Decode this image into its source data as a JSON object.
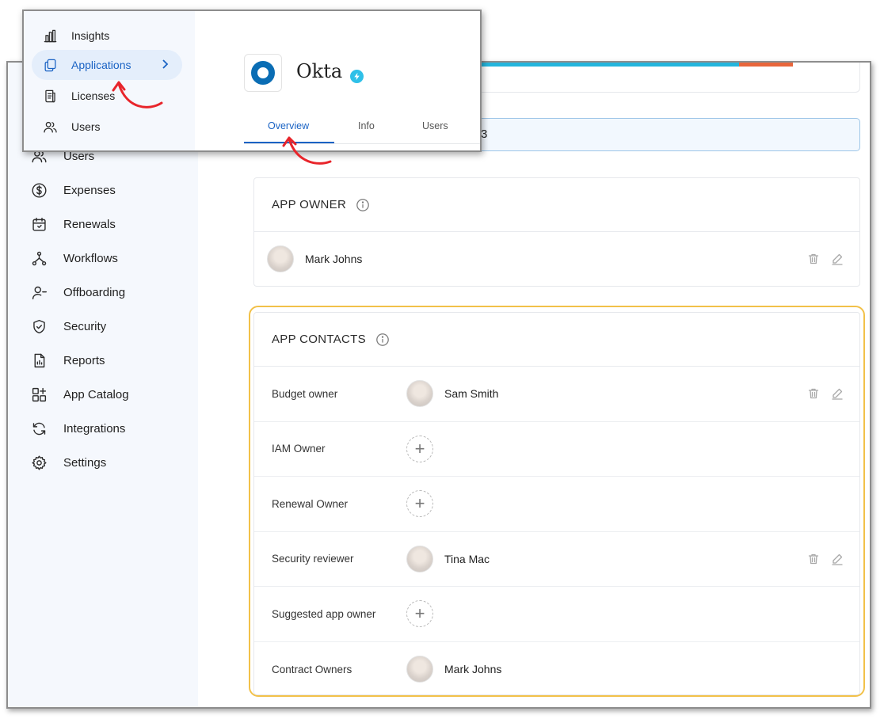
{
  "sidebar": {
    "items": [
      {
        "label": "Users",
        "icon": "users-icon"
      },
      {
        "label": "Expenses",
        "icon": "dollar-icon"
      },
      {
        "label": "Renewals",
        "icon": "calendar-icon"
      },
      {
        "label": "Workflows",
        "icon": "workflow-icon"
      },
      {
        "label": "Offboarding",
        "icon": "user-minus-icon"
      },
      {
        "label": "Security",
        "icon": "shield-icon"
      },
      {
        "label": "Reports",
        "icon": "report-icon"
      },
      {
        "label": "App Catalog",
        "icon": "grid-plus-icon"
      },
      {
        "label": "Integrations",
        "icon": "sync-icon"
      },
      {
        "label": "Settings",
        "icon": "gear-icon"
      }
    ]
  },
  "banner": {
    "fragment": "3"
  },
  "app_owner": {
    "title": "APP OWNER",
    "owner_name": "Mark Johns"
  },
  "app_contacts": {
    "title": "APP CONTACTS",
    "rows": [
      {
        "label": "Budget owner",
        "name": "Sam Smith"
      },
      {
        "label": "IAM Owner",
        "name": ""
      },
      {
        "label": "Renewal Owner",
        "name": ""
      },
      {
        "label": "Security reviewer",
        "name": "Tina Mac"
      },
      {
        "label": "Suggested app owner",
        "name": ""
      },
      {
        "label": "Contract Owners",
        "name": "Mark Johns"
      }
    ]
  },
  "popup": {
    "nav": [
      {
        "label": "Insights",
        "icon": "bar-chart-icon"
      },
      {
        "label": "Applications",
        "icon": "copy-icon"
      },
      {
        "label": "Licenses",
        "icon": "document-icon"
      },
      {
        "label": "Users",
        "icon": "users-icon"
      }
    ],
    "app_name": "Okta",
    "tabs": [
      "Overview",
      "Info",
      "Users"
    ]
  },
  "colors": {
    "accent": "#1a63c4",
    "highlight": "#f2c149",
    "annotation_arrow": "#e8252b",
    "progress_blue": "#24b5dc",
    "progress_orange": "#e8663c"
  }
}
